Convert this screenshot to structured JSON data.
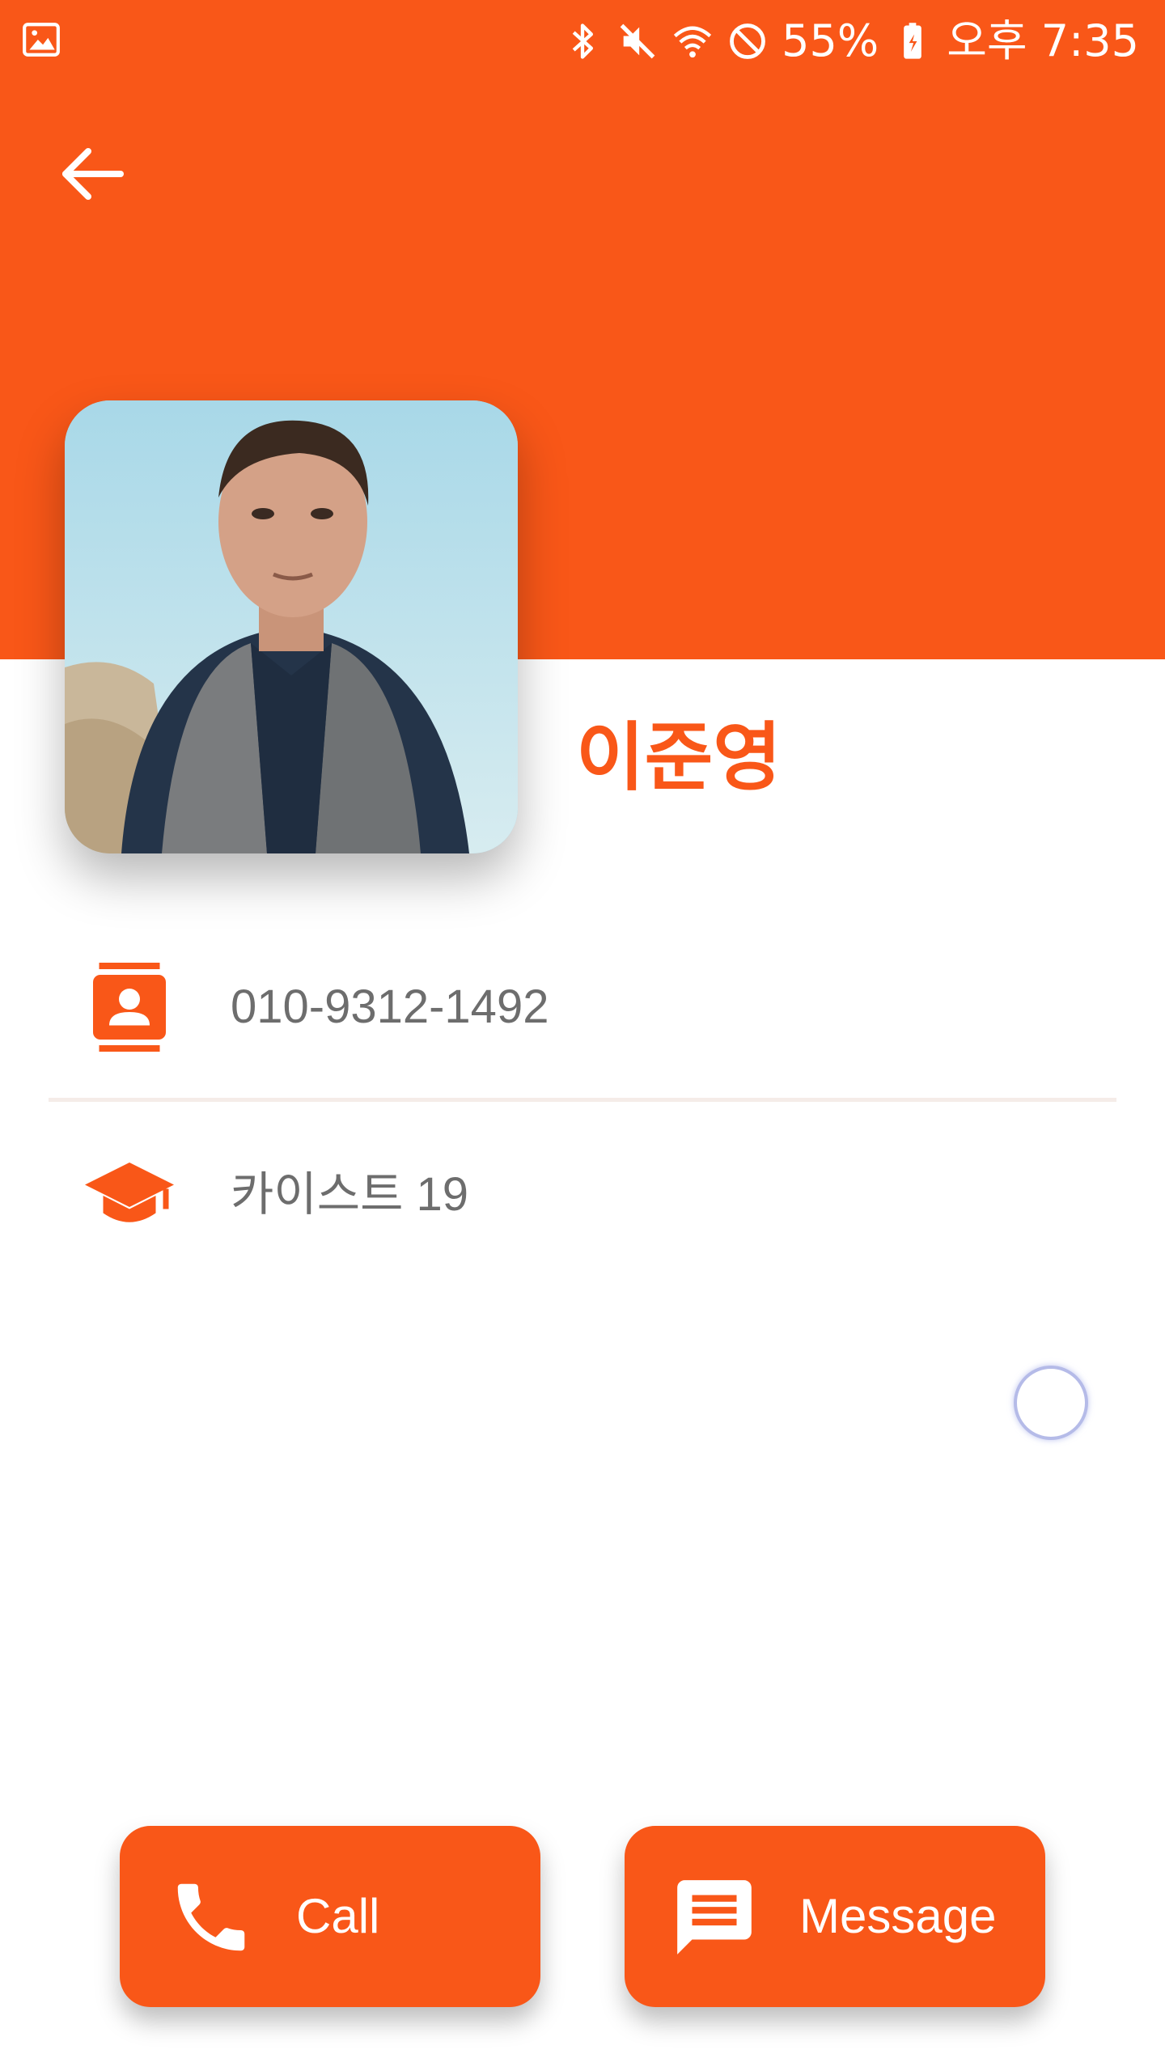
{
  "status_bar": {
    "battery": "55%",
    "time": "오후 7:35",
    "icons": [
      "gallery-icon",
      "bluetooth-icon",
      "mute-icon",
      "wifi-icon",
      "do-not-disturb-icon",
      "battery-charging-icon"
    ]
  },
  "header": {
    "back_icon": "arrow-left-icon",
    "color": "#f95718"
  },
  "profile": {
    "name": "이준영",
    "photo": "person-photo"
  },
  "info": {
    "phone": "010-9312-1492",
    "school": "카이스트 19"
  },
  "actions": {
    "call_label": "Call",
    "message_label": "Message"
  },
  "colors": {
    "accent": "#f95718",
    "text": "#6d6d6d",
    "divider": "#f5ece8"
  }
}
